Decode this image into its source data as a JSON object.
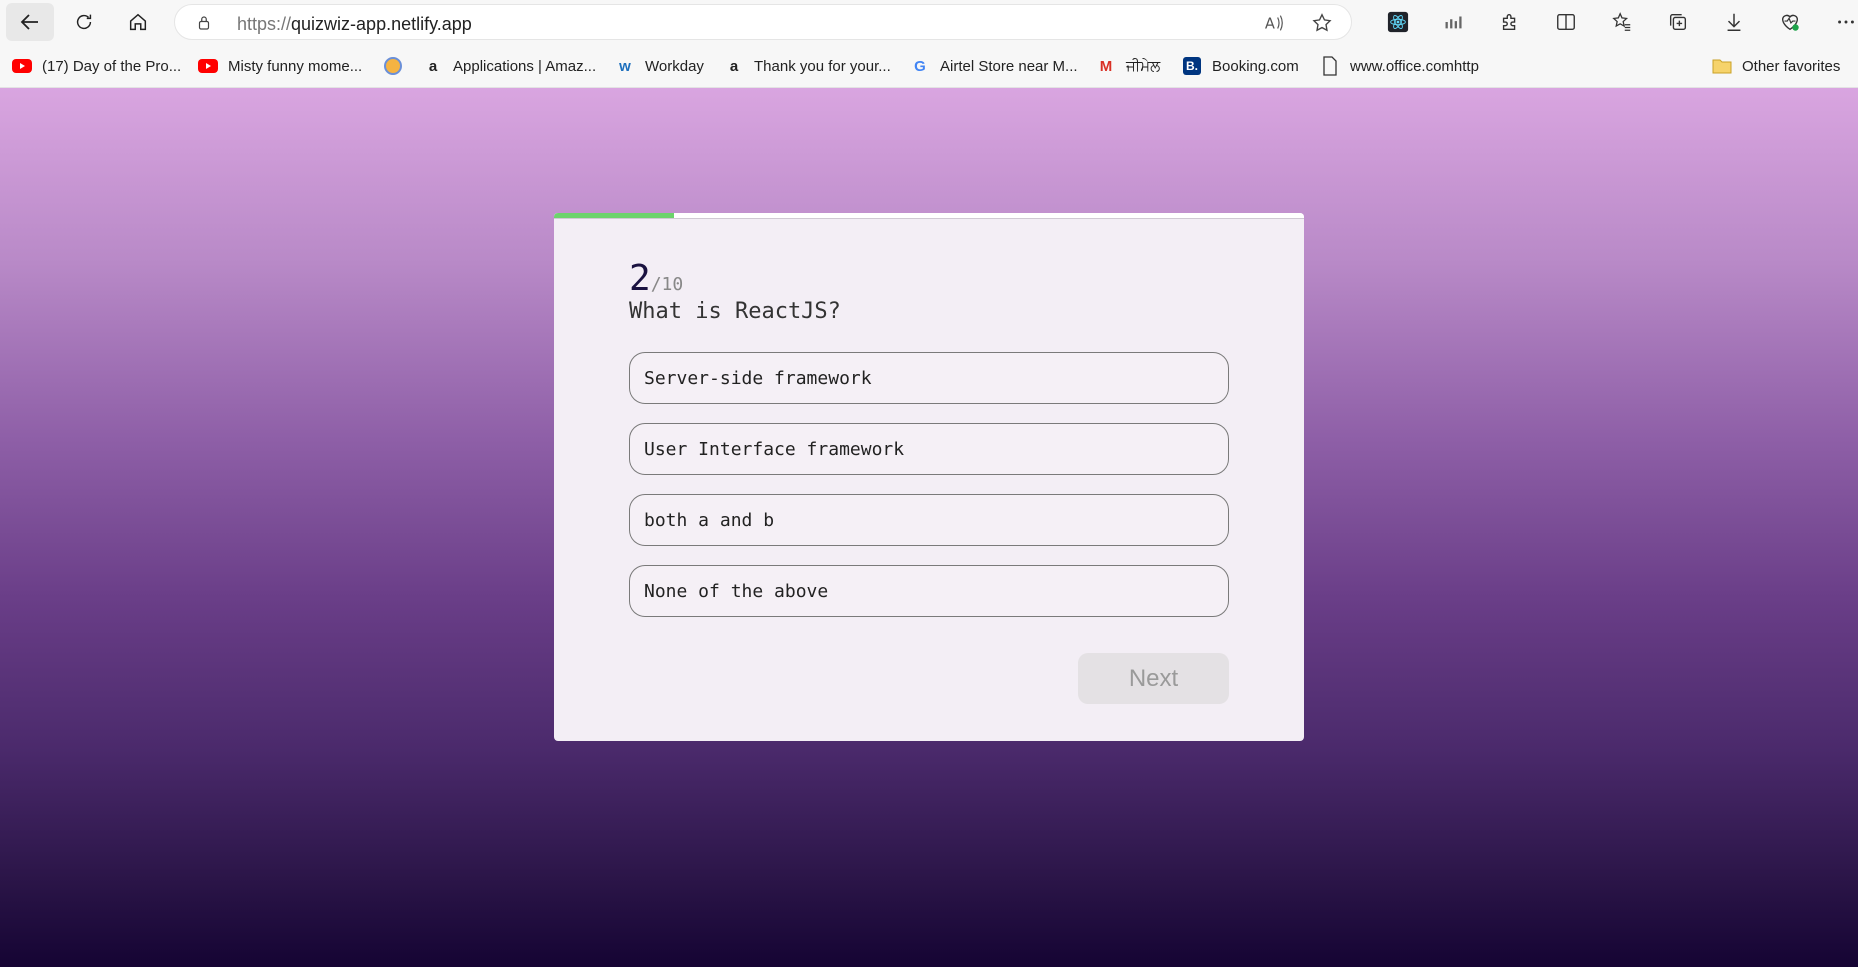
{
  "browser": {
    "url_protocol": "https://",
    "url_host": "quizwiz-app.netlify.app"
  },
  "bookmarks": [
    {
      "label": "(17) Day of the Pro...",
      "icon": "youtube-icon"
    },
    {
      "label": "Misty funny mome...",
      "icon": "youtube-icon"
    },
    {
      "label": "",
      "icon": "circle-icon"
    },
    {
      "label": "Applications | Amaz...",
      "icon": "amazon-icon"
    },
    {
      "label": "Workday",
      "icon": "workday-icon"
    },
    {
      "label": "Thank you for your...",
      "icon": "amazon-icon"
    },
    {
      "label": "Airtel Store near M...",
      "icon": "google-icon"
    },
    {
      "label": "ਜੀਮੇਲ",
      "icon": "gmail-icon"
    },
    {
      "label": "Booking.com",
      "icon": "booking-icon"
    },
    {
      "label": "www.office.comhttp",
      "icon": "page-icon"
    }
  ],
  "other_favorites": "Other favorites",
  "quiz": {
    "current": "2",
    "total": "/10",
    "progress": 0.16,
    "question": "What is ReactJS?",
    "options": [
      "Server-side framework",
      "User Interface framework",
      "both a and b",
      "None of the above"
    ],
    "next_label": "Next"
  },
  "colors": {
    "progress": "#6cd36c",
    "gradient_top": "#d9a5e0",
    "gradient_bottom": "#150433"
  }
}
